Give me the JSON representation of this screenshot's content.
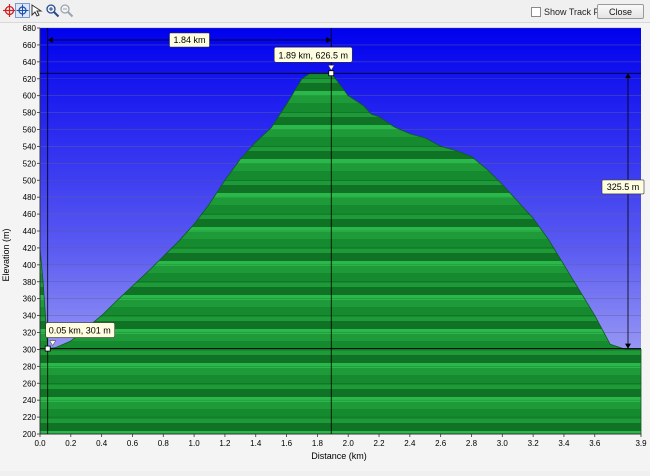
{
  "toolbar": {
    "tools": [
      {
        "icon": "crosshair-icon",
        "active": false
      },
      {
        "icon": "measure-icon",
        "active": true
      },
      {
        "icon": "cursor-arrow-icon",
        "active": false
      },
      {
        "icon": "zoom-in-icon",
        "active": false
      },
      {
        "icon": "zoom-out-icon",
        "active": false
      }
    ],
    "show_track_points_label": "Show Track Points",
    "show_track_points_checked": false,
    "close_label": "Close"
  },
  "chart_data": {
    "type": "area",
    "xlabel": "Distance (km)",
    "ylabel": "Elevation (m)",
    "xlim": [
      0,
      3.9
    ],
    "ylim": [
      200,
      680
    ],
    "x_ticks": [
      "0.0",
      "0.2",
      "0.4",
      "0.6",
      "0.8",
      "1.0",
      "1.2",
      "1.4",
      "1.6",
      "1.8",
      "2.0",
      "2.2",
      "2.4",
      "2.6",
      "2.8",
      "3.0",
      "3.2",
      "3.4",
      "3.6",
      "3.9"
    ],
    "y_ticks": [
      "200",
      "220",
      "240",
      "260",
      "280",
      "300",
      "320",
      "340",
      "360",
      "380",
      "400",
      "420",
      "440",
      "460",
      "480",
      "500",
      "520",
      "540",
      "560",
      "580",
      "600",
      "620",
      "640",
      "660",
      "680"
    ],
    "grid": true,
    "colors": {
      "fill": "#1f9e3a",
      "fill_dark": "#0f6e22",
      "sky_top": "#0000ee",
      "sky_bottom": "#c8c8f6"
    },
    "series": [
      {
        "x": [
          0.0,
          0.02,
          0.05,
          0.1,
          0.2,
          0.3,
          0.4,
          0.5,
          0.6,
          0.7,
          0.8,
          0.9,
          1.0,
          1.1,
          1.2,
          1.3,
          1.4,
          1.5,
          1.6,
          1.65,
          1.7,
          1.75,
          1.8,
          1.85,
          1.89,
          1.95,
          2.0,
          2.05,
          2.1,
          2.15,
          2.2,
          2.3,
          2.4,
          2.5,
          2.6,
          2.7,
          2.8,
          2.9,
          3.0,
          3.1,
          3.2,
          3.3,
          3.4,
          3.5,
          3.6,
          3.7,
          3.8,
          3.9
        ],
        "y": [
          420,
          380,
          301,
          302,
          310,
          325,
          340,
          358,
          375,
          392,
          410,
          428,
          448,
          472,
          500,
          525,
          545,
          562,
          590,
          605,
          620,
          626,
          626,
          626,
          626.5,
          612,
          600,
          594,
          588,
          578,
          575,
          563,
          555,
          550,
          540,
          535,
          528,
          513,
          495,
          475,
          455,
          430,
          400,
          370,
          340,
          306,
          300,
          300
        ]
      }
    ],
    "annotations": {
      "point_a": {
        "label": "0.05 km, 301 m",
        "x": 0.05,
        "y": 301
      },
      "point_b": {
        "label": "1.89 km, 626.5 m",
        "x": 1.89,
        "y": 626.5
      },
      "distance_label": "1.84 km",
      "elevation_diff_label": "325.5 m"
    }
  }
}
